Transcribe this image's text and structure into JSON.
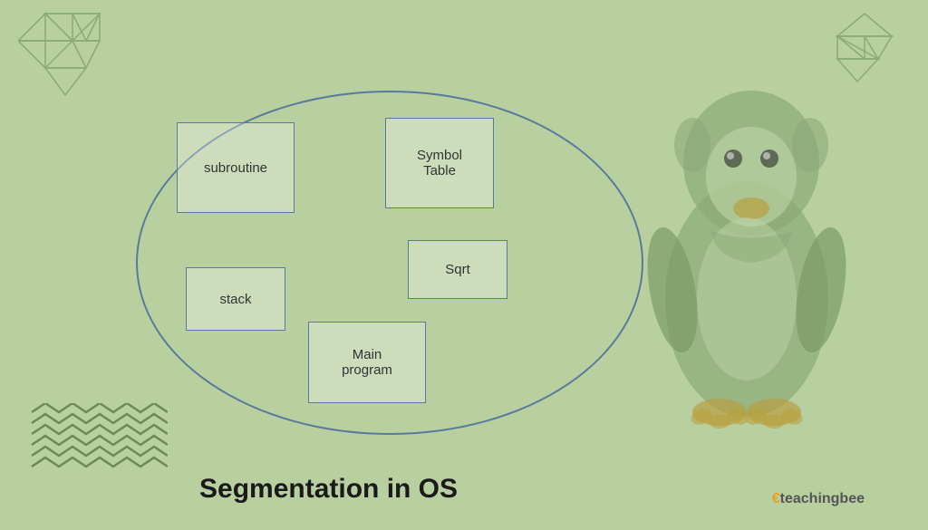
{
  "page": {
    "background_color": "#b8cfa0",
    "title": "Segmentation in OS",
    "brand": {
      "logo_text": "teachingbee",
      "logo_prefix": "E",
      "logo_prefix_color": "#e8a020"
    }
  },
  "segments": {
    "subroutine": {
      "label": "subroutine"
    },
    "symbol_table": {
      "label": "Symbol\nTable"
    },
    "stack": {
      "label": "stack"
    },
    "sqrt": {
      "label": "Sqrt"
    },
    "main_program": {
      "label": "Main\nprogram"
    }
  },
  "decorations": {
    "geo_top_left": "geometric-diamond-icon",
    "geo_top_right": "geometric-diamond-icon",
    "zigzag_bottom_left": "zigzag-pattern-icon",
    "tux_penguin": "linux-tux-icon"
  }
}
